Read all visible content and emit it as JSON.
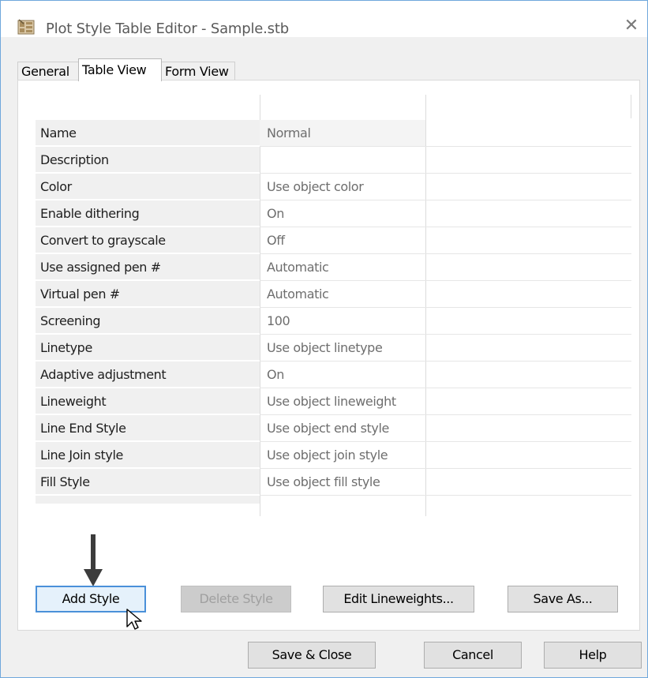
{
  "window": {
    "title": "Plot Style Table Editor - Sample.stb",
    "close_glyph": "✕"
  },
  "tabs": [
    {
      "label": "General",
      "active": false
    },
    {
      "label": "Table View",
      "active": true
    },
    {
      "label": "Form View",
      "active": false
    }
  ],
  "properties": [
    {
      "name": "Name",
      "value": "Normal"
    },
    {
      "name": "Description",
      "value": ""
    },
    {
      "name": "Color",
      "value": "Use object color"
    },
    {
      "name": "Enable dithering",
      "value": "On"
    },
    {
      "name": "Convert to grayscale",
      "value": "Off"
    },
    {
      "name": "Use assigned pen #",
      "value": "Automatic"
    },
    {
      "name": "Virtual pen #",
      "value": "Automatic"
    },
    {
      "name": "Screening",
      "value": "100"
    },
    {
      "name": "Linetype",
      "value": "Use object linetype"
    },
    {
      "name": "Adaptive adjustment",
      "value": "On"
    },
    {
      "name": "Lineweight",
      "value": "Use object lineweight"
    },
    {
      "name": "Line End Style",
      "value": "Use object end style"
    },
    {
      "name": "Line Join style",
      "value": "Use object join style"
    },
    {
      "name": "Fill Style",
      "value": "Use object fill style"
    }
  ],
  "panel_buttons": {
    "add_style": "Add Style",
    "delete_style": "Delete Style",
    "edit_lineweights": "Edit Lineweights...",
    "save_as": "Save As..."
  },
  "footer_buttons": {
    "save_close": "Save & Close",
    "cancel": "Cancel",
    "help": "Help"
  },
  "icons": {
    "app": "plot-style-table-icon",
    "close": "close-icon",
    "annotation": "arrow-down-icon",
    "pointer": "mouse-pointer-icon"
  },
  "colors": {
    "window_border": "#6fa8dc",
    "default_button_border": "#4a90d9",
    "default_button_fill": "#e5f1fb",
    "annotation_arrow": "#3c3c3c"
  }
}
